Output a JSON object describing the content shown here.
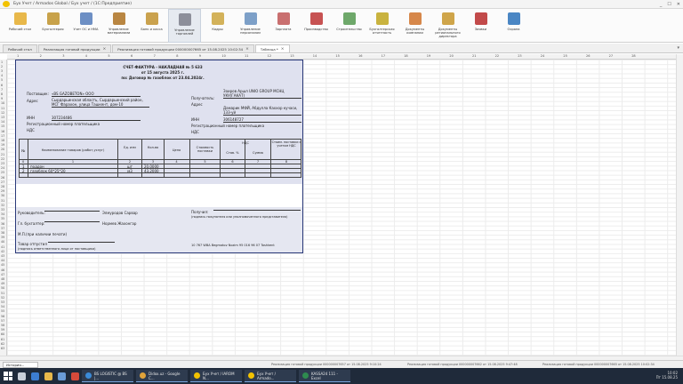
{
  "window": {
    "title": "Бух Учет / Armados Global / Бух учет /  (1С:Предприятие)",
    "controls": [
      "_",
      "☐",
      "✕"
    ]
  },
  "toolbar": [
    {
      "label": "Рабочий стол",
      "icon": "desktop-icon",
      "color": "#e8b84a"
    },
    {
      "label": "Бухгалтерия",
      "icon": "ledger-icon",
      "color": "#c8a24a"
    },
    {
      "label": "Учет ОС и НМА",
      "icon": "assets-icon",
      "color": "#6d8fc4"
    },
    {
      "label": "Управление материалами",
      "icon": "materials-icon",
      "color": "#b98642"
    },
    {
      "label": "Банк и касса",
      "icon": "bank-icon",
      "color": "#caa24e"
    },
    {
      "label": "Управление торговлей",
      "icon": "trade-icon",
      "color": "#8d8f9a"
    },
    {
      "label": "Кадры",
      "icon": "staff-icon",
      "color": "#d3b25a"
    },
    {
      "label": "Управление персоналом",
      "icon": "personnel-icon",
      "color": "#7da0c8"
    },
    {
      "label": "Зарплата",
      "icon": "salary-icon",
      "color": "#c96f6f"
    },
    {
      "label": "Производство",
      "icon": "production-icon",
      "color": "#c75252"
    },
    {
      "label": "Строительство",
      "icon": "construction-icon",
      "color": "#6ea86a"
    },
    {
      "label": "Бухгалтерская отчетность",
      "icon": "reports-icon",
      "color": "#c9b33f"
    },
    {
      "label": "Документы компании",
      "icon": "documents-icon",
      "color": "#d6874a"
    },
    {
      "label": "Документы регионального директора",
      "icon": "regional-docs-icon",
      "color": "#cfa54a"
    },
    {
      "label": "Заявки",
      "icon": "requests-icon",
      "color": "#c24a4a"
    },
    {
      "label": "Охрана",
      "icon": "security-icon",
      "color": "#4a86c4"
    }
  ],
  "tabs": [
    {
      "label": "Рабочий стол",
      "active": false
    },
    {
      "label": "Реализация готовой продукции",
      "active": false
    },
    {
      "label": "Реализация готовой продукции 000000007665 от 15.08.2025 10:02:34",
      "active": false
    },
    {
      "label": "Таблица *",
      "active": true
    }
  ],
  "columns": [
    "1",
    "2",
    "3",
    "4",
    "5",
    "6",
    "7",
    "8",
    "9",
    "10",
    "11",
    "12",
    "13",
    "14",
    "15",
    "16",
    "17",
    "18",
    "19",
    "20",
    "21",
    "22",
    "23",
    "24",
    "25",
    "26",
    "27",
    "28"
  ],
  "rows": [
    "1",
    "2",
    "3",
    "4",
    "5",
    "6",
    "7",
    "8",
    "9",
    "10",
    "11",
    "12",
    "13",
    "14",
    "15",
    "16",
    "17",
    "18",
    "19",
    "20",
    "21",
    "22",
    "23",
    "24",
    "25",
    "26",
    "27",
    "28",
    "29",
    "30",
    "31",
    "32",
    "33",
    "34",
    "35",
    "36",
    "37",
    "38",
    "39",
    "40",
    "41",
    "42",
    "43",
    "44",
    "45",
    "46",
    "47",
    "48",
    "49",
    "50",
    "51",
    "52",
    "53",
    "54",
    "55",
    "56",
    "57",
    "58",
    "59",
    "60",
    "61",
    "62",
    "63"
  ],
  "invoice": {
    "heading": "СЧЕТ-ФАКТУРА - НАКЛАДНАЯ № 5 633",
    "date": "от 15 августа 2025 г.",
    "contract": "по: Договор № газоблок от 23.04.2024г.",
    "supplier_label": "Поставщик:",
    "supplier": "«BS GAZOBETON» ООО",
    "address_label": "Адрес",
    "supplier_address": "Сырдарьинская область, Сырдарьинский район, МСГ Фарахон, улица Ташкент, дом-10",
    "inn_label": "ИНН",
    "supplier_inn": "307234486",
    "regnum_label": "Регистрационный номер плательщика",
    "nds_label": "НДС",
    "buyer_label": "Получатель:",
    "buyer": "Зоиров Аршл UNIO GROUP МСНЦ УКУ(ГАКАТ)",
    "buyer_address": "Дамарик МФЙ, Абдулла Каххор кучаси, 133-уй",
    "buyer_inn": "306148727",
    "table_headers": {
      "num": "№",
      "name": "Наименование товаров (работ,услуг)",
      "unit": "Ед. изм",
      "qty": "Кол-во",
      "price": "Цена",
      "cost": "Стоимость поставки",
      "vat": "НДС",
      "vat_rate": "Став. %",
      "vat_sum": "Сумма",
      "total": "Стоим. поставки с учетом НДС"
    },
    "index_row": [
      "0",
      "1",
      "2",
      "3",
      "4",
      "5",
      "6",
      "7",
      "8"
    ],
    "items": [
      {
        "n": "1",
        "name": "поддон",
        "unit": "шт",
        "qty": "20,0000"
      },
      {
        "n": "2",
        "name": "газоблок 60*25*20",
        "unit": "м3",
        "qty": "43,2000"
      }
    ],
    "director_label": "Руководитель:",
    "director": "Элмуродов Сарвар",
    "accountant_label": "Гл. бухгалтер:",
    "accountant": "Нормев Жахонгар",
    "stamp": "М.П.(при наличии печати)",
    "released_label": "Товар  отпустил",
    "released_sign": "(подпись ответственного лица от поставщика)",
    "received_label": "Получил:",
    "received_sign": "(подпись покупателя или уполномоченного представителя)",
    "footer_note": "10 767 WBA Begmatov Nozim 95 016 96 07 Toshkent"
  },
  "status": {
    "history": "История...",
    "items": [
      "Реализация готовой продукции 000000007657 от 15.08.2025 9:10:24",
      "Реализация готовой продукции 000000007662 от 15.08.2025 9:47:48",
      "Реализация готовой продукции 000000007665 от 15.08.2025 10:02:34"
    ]
  },
  "taskbar": {
    "apps": [
      {
        "label": "BS LOGISTIC @ BS |...",
        "color": "#3b8bd8"
      },
      {
        "label": "Didox.uz - Google C...",
        "color": "#e0a33a"
      },
      {
        "label": "Бух Учет / IAROM N...",
        "color": "#f2c200"
      },
      {
        "label": "Бух Учет / Armado...",
        "color": "#f2c200"
      },
      {
        "label": "KASSA24 111 - Excel",
        "color": "#2e8b4f"
      }
    ],
    "time": "10:02",
    "date": "Пт 15.08.25"
  }
}
